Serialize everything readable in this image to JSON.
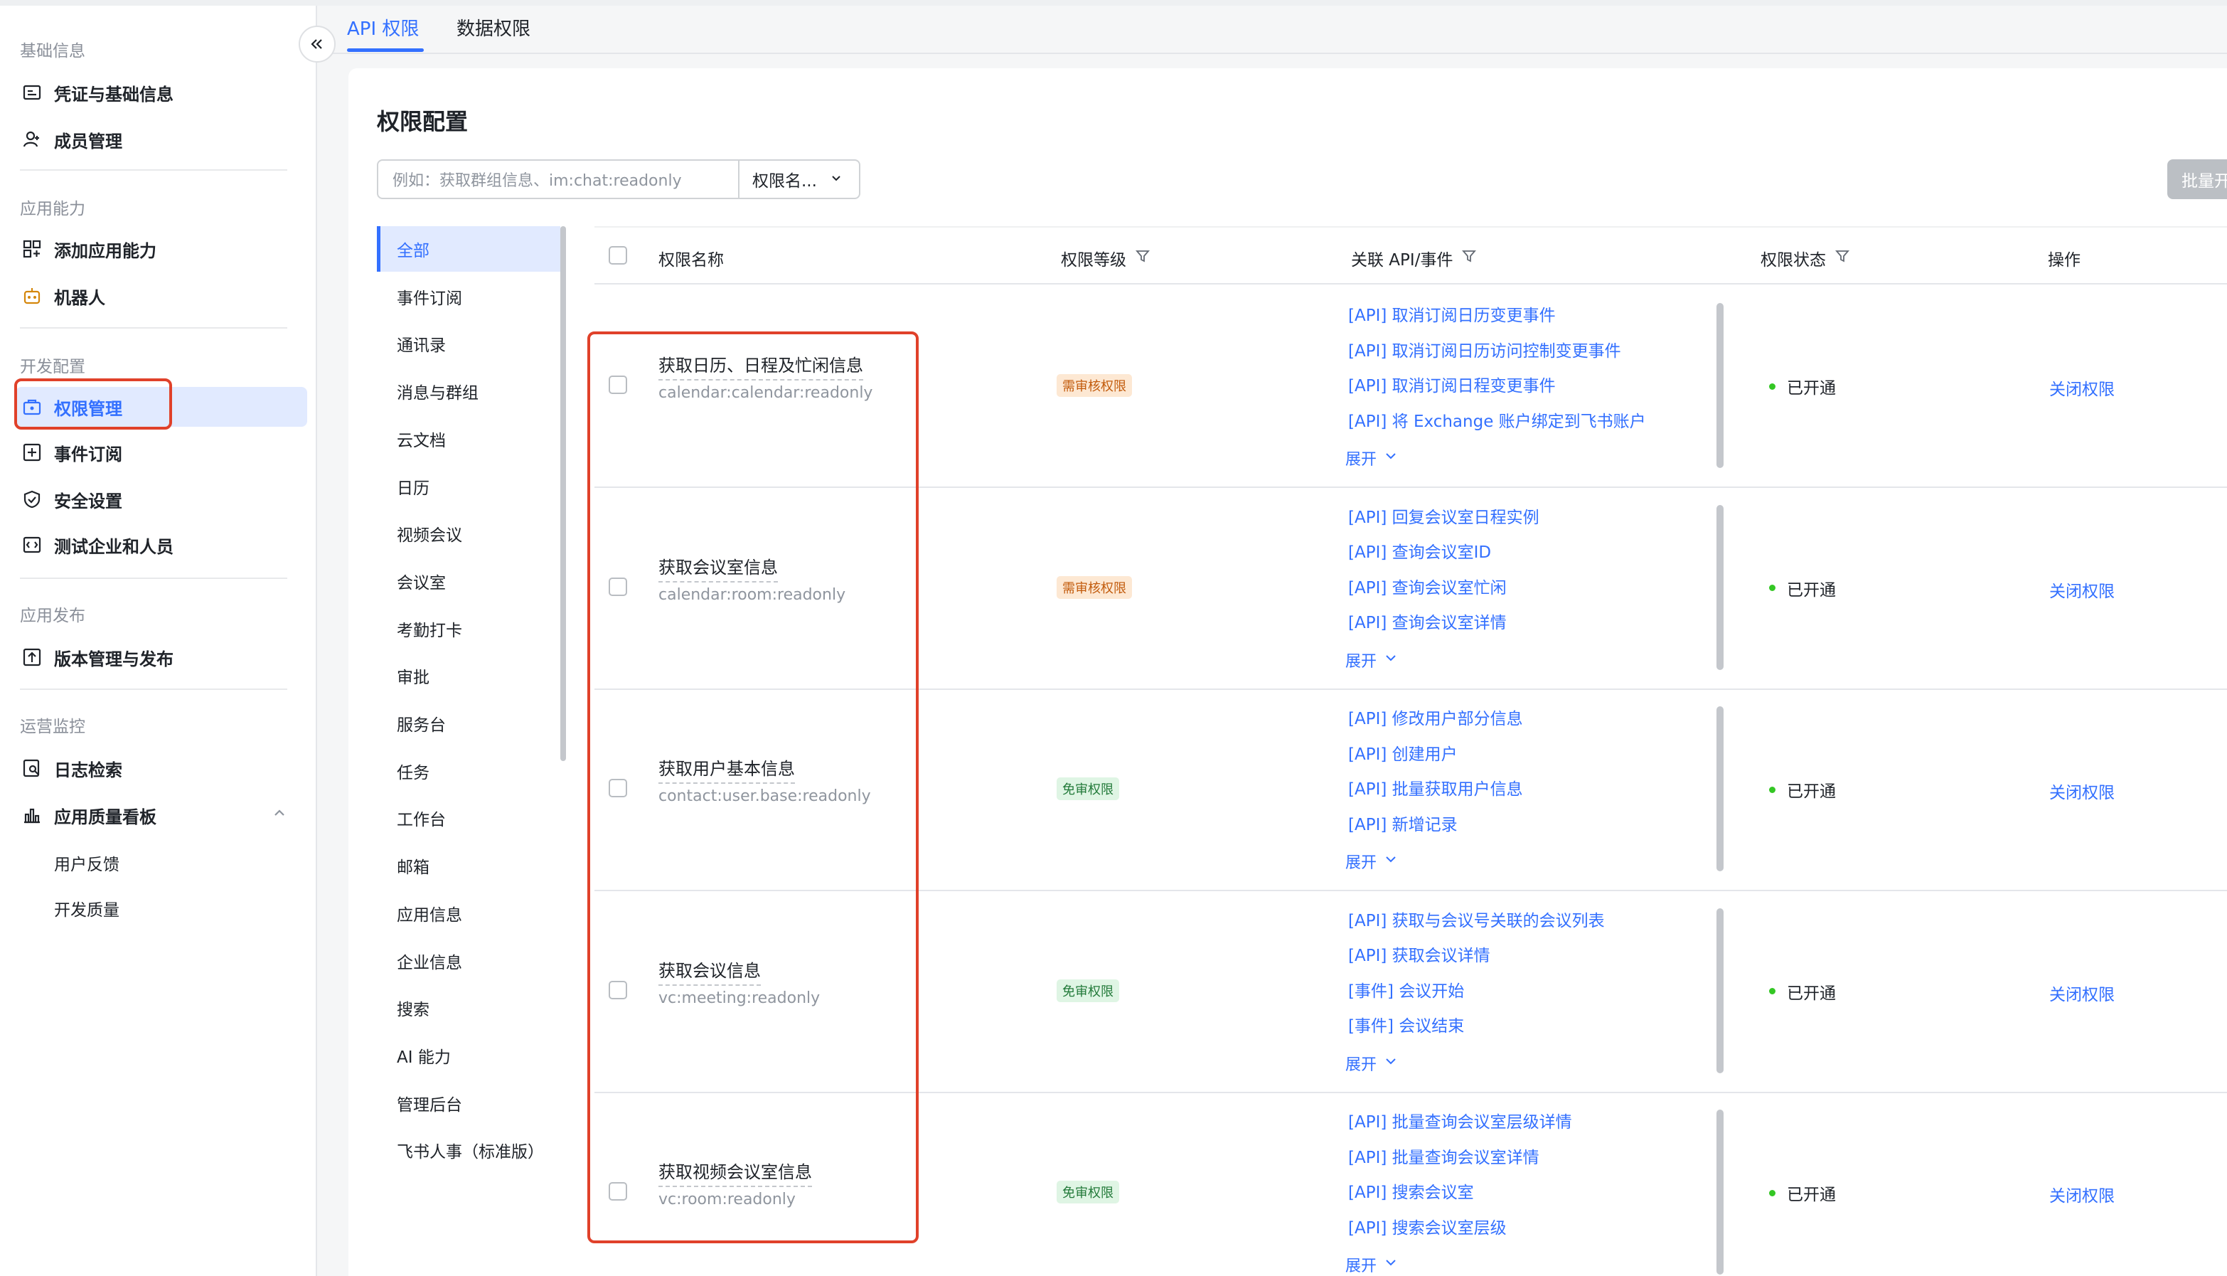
{
  "sidebar": {
    "sections": [
      {
        "title": "基础信息",
        "items": [
          {
            "label": "凭证与基础信息",
            "icon": "credential-icon"
          },
          {
            "label": "成员管理",
            "icon": "member-icon"
          }
        ]
      },
      {
        "title": "应用能力",
        "items": [
          {
            "label": "添加应用能力",
            "icon": "add-capability-icon"
          },
          {
            "label": "机器人",
            "icon": "robot-icon"
          }
        ]
      },
      {
        "title": "开发配置",
        "items": [
          {
            "label": "权限管理",
            "icon": "permission-icon",
            "active": true
          },
          {
            "label": "事件订阅",
            "icon": "event-icon"
          },
          {
            "label": "安全设置",
            "icon": "shield-icon"
          },
          {
            "label": "测试企业和人员",
            "icon": "test-icon"
          }
        ]
      },
      {
        "title": "应用发布",
        "items": [
          {
            "label": "版本管理与发布",
            "icon": "publish-icon"
          }
        ]
      },
      {
        "title": "运营监控",
        "items": [
          {
            "label": "日志检索",
            "icon": "log-search-icon"
          },
          {
            "label": "应用质量看板",
            "icon": "chart-icon",
            "expanded": true
          }
        ],
        "subitems": [
          "用户反馈",
          "开发质量"
        ]
      }
    ]
  },
  "tabs": [
    {
      "label": "API 权限",
      "active": true
    },
    {
      "label": "数据权限",
      "active": false
    }
  ],
  "main": {
    "title": "权限配置",
    "search_placeholder": "例如：获取群组信息、im:chat:readonly",
    "search_scope": "权限名...",
    "batch_button": "批量开",
    "categories": [
      "全部",
      "事件订阅",
      "通讯录",
      "消息与群组",
      "云文档",
      "日历",
      "视频会议",
      "会议室",
      "考勤打卡",
      "审批",
      "服务台",
      "任务",
      "工作台",
      "邮箱",
      "应用信息",
      "企业信息",
      "搜索",
      "AI 能力",
      "管理后台",
      "飞书人事（标准版）"
    ],
    "columns": {
      "name": "权限名称",
      "level": "权限等级",
      "api": "关联 API/事件",
      "status": "权限状态",
      "action": "操作"
    },
    "expand_label": "展开",
    "rows": [
      {
        "name": "获取日历、日程及忙闲信息",
        "code": "calendar:calendar:readonly",
        "level": "需审核权限",
        "level_type": "review",
        "apis": [
          "[API] 取消订阅日历变更事件",
          "[API] 取消订阅日历访问控制变更事件",
          "[API] 取消订阅日程变更事件",
          "[API] 将 Exchange 账户绑定到飞书账户"
        ],
        "status": "已开通",
        "action": "关闭权限"
      },
      {
        "name": "获取会议室信息",
        "code": "calendar:room:readonly",
        "level": "需审核权限",
        "level_type": "review",
        "apis": [
          "[API] 回复会议室日程实例",
          "[API] 查询会议室ID",
          "[API] 查询会议室忙闲",
          "[API] 查询会议室详情"
        ],
        "status": "已开通",
        "action": "关闭权限"
      },
      {
        "name": "获取用户基本信息",
        "code": "contact:user.base:readonly",
        "level": "免审权限",
        "level_type": "free",
        "apis": [
          "[API] 修改用户部分信息",
          "[API] 创建用户",
          "[API] 批量获取用户信息",
          "[API] 新增记录"
        ],
        "status": "已开通",
        "action": "关闭权限"
      },
      {
        "name": "获取会议信息",
        "code": "vc:meeting:readonly",
        "level": "免审权限",
        "level_type": "free",
        "apis": [
          "[API] 获取与会议号关联的会议列表",
          "[API] 获取会议详情",
          "[事件] 会议开始",
          "[事件] 会议结束"
        ],
        "status": "已开通",
        "action": "关闭权限"
      },
      {
        "name": "获取视频会议室信息",
        "code": "vc:room:readonly",
        "level": "免审权限",
        "level_type": "free",
        "apis": [
          "[API] 批量查询会议室层级详情",
          "[API] 批量查询会议室详情",
          "[API] 搜索会议室",
          "[API] 搜索会议室层级"
        ],
        "status": "已开通",
        "action": "关闭权限"
      }
    ]
  },
  "colors": {
    "accent": "#3370ff",
    "highlight": "#e0412a",
    "status_on": "#34c724"
  }
}
